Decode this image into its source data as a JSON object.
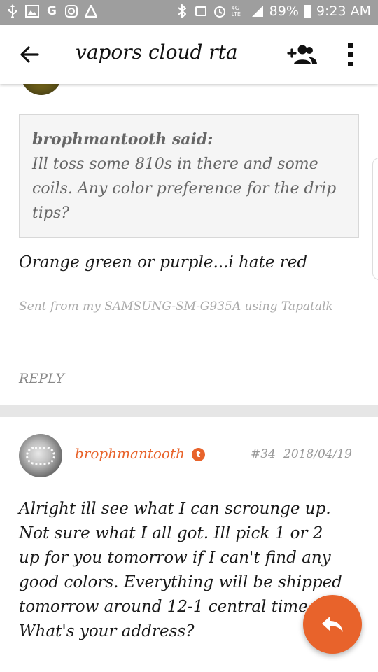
{
  "status_bar": {
    "battery": "89%",
    "time": "9:23 AM",
    "signal_label": "4G LTE"
  },
  "app_bar": {
    "title": "vapors cloud rta"
  },
  "previous_post": {
    "quote": {
      "author": "brophmantooth said:",
      "text": "Ill toss some 810s in there and some coils. Any color preference for the drip tips?"
    },
    "message": "Orange green or purple...i hate red",
    "signature": "Sent from my SAMSUNG-SM-G935A using Tapatalk",
    "reply_label": "REPLY"
  },
  "post": {
    "username": "brophmantooth",
    "badge": "t",
    "number": "#34",
    "date": "2018/04/19",
    "body_lines": [
      "Alright ill see what I can scrounge up.",
      "Not sure what I all got. Ill pick 1 or 2",
      "up for you tomorrow if I can't find any",
      "good colors. Everything will be shipped",
      "tomorrow around 12-1 central time",
      "What's your address?"
    ]
  },
  "colors": {
    "accent": "#e8632b",
    "status_bar": "#9e9e9e",
    "divider": "#e6e6e6",
    "quote_bg": "#f5f5f5"
  },
  "icons": {
    "back": "arrow-left-icon",
    "add_user": "add-user-icon",
    "menu": "more-vert-icon",
    "fab": "reply-icon"
  }
}
